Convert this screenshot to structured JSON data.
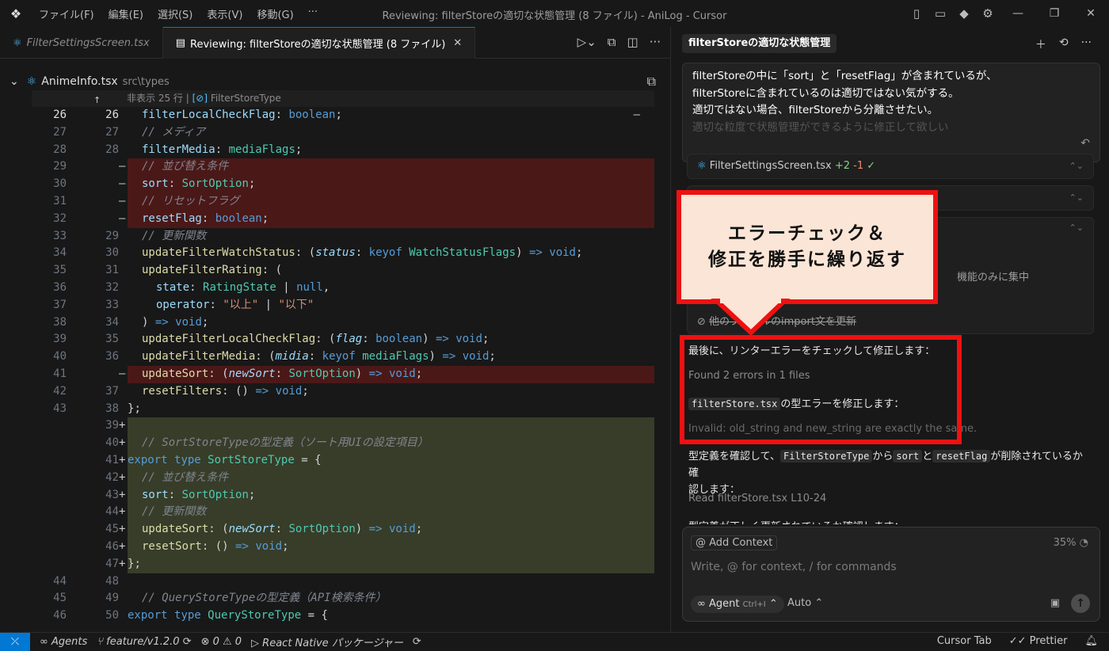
{
  "app": {
    "window_title": "Reviewing: filterStoreの適切な状態管理 (8 ファイル) - AniLog - Cursor",
    "menu": [
      "ファイル(F)",
      "編集(E)",
      "選択(S)",
      "表示(V)",
      "移動(G)",
      "···"
    ]
  },
  "tabs": [
    {
      "label": "FilterSettingsScreen.tsx"
    },
    {
      "label": "Reviewing: filterStoreの適切な状態管理 (8 ファイル)"
    }
  ],
  "breadcrumb": {
    "file": "AnimeInfo.tsx",
    "path": "src\\types"
  },
  "code": {
    "hidden_label": "非表示 25 行 | ",
    "hidden_symbol": "FilterStoreType",
    "lines": [
      {
        "o": "26",
        "n": "26",
        "t": "",
        "text": "filterLocalCheckFlag: boolean;"
      },
      {
        "o": "27",
        "n": "27",
        "t": "",
        "text": "// メディア"
      },
      {
        "o": "28",
        "n": "28",
        "t": "",
        "text": "filterMedia: mediaFlags;"
      },
      {
        "o": "29",
        "n": "",
        "t": "del",
        "text": "// 並び替え条件"
      },
      {
        "o": "30",
        "n": "",
        "t": "del",
        "text": "sort: SortOption;"
      },
      {
        "o": "31",
        "n": "",
        "t": "del",
        "text": "// リセットフラグ"
      },
      {
        "o": "32",
        "n": "",
        "t": "del",
        "text": "resetFlag: boolean;"
      },
      {
        "o": "33",
        "n": "29",
        "t": "",
        "text": "// 更新関数"
      },
      {
        "o": "34",
        "n": "30",
        "t": "",
        "text": "updateFilterWatchStatus: (status: keyof WatchStatusFlags) => void;"
      },
      {
        "o": "35",
        "n": "31",
        "t": "",
        "text": "updateFilterRating: ("
      },
      {
        "o": "36",
        "n": "32",
        "t": "",
        "text": "state: RatingState | null,"
      },
      {
        "o": "37",
        "n": "33",
        "t": "",
        "text": "operator: \"以上\" | \"以下\""
      },
      {
        "o": "38",
        "n": "34",
        "t": "",
        "text": ") => void;"
      },
      {
        "o": "39",
        "n": "35",
        "t": "",
        "text": "updateFilterLocalCheckFlag: (flag: boolean) => void;"
      },
      {
        "o": "40",
        "n": "36",
        "t": "",
        "text": "updateFilterMedia: (midia: keyof mediaFlags) => void;"
      },
      {
        "o": "41",
        "n": "",
        "t": "del",
        "text": "updateSort: (newSort: SortOption) => void;"
      },
      {
        "o": "42",
        "n": "37",
        "t": "",
        "text": "resetFilters: () => void;"
      },
      {
        "o": "43",
        "n": "38",
        "t": "",
        "text": "};"
      },
      {
        "o": "",
        "n": "39",
        "t": "add",
        "text": ""
      },
      {
        "o": "",
        "n": "40",
        "t": "add",
        "text": "// SortStoreTypeの型定義（ソート用UIの設定項目）"
      },
      {
        "o": "",
        "n": "41",
        "t": "add",
        "text": "export type SortStoreType = {"
      },
      {
        "o": "",
        "n": "42",
        "t": "add",
        "text": "// 並び替え条件"
      },
      {
        "o": "",
        "n": "43",
        "t": "add",
        "text": "sort: SortOption;"
      },
      {
        "o": "",
        "n": "44",
        "t": "add",
        "text": "// 更新関数"
      },
      {
        "o": "",
        "n": "45",
        "t": "add",
        "text": "updateSort: (newSort: SortOption) => void;"
      },
      {
        "o": "",
        "n": "46",
        "t": "add",
        "text": "resetSort: () => void;"
      },
      {
        "o": "",
        "n": "47",
        "t": "add",
        "text": "};"
      },
      {
        "o": "44",
        "n": "48",
        "t": "",
        "text": ""
      },
      {
        "o": "45",
        "n": "49",
        "t": "",
        "text": "// QueryStoreTypeの型定義（API検索条件）"
      },
      {
        "o": "46",
        "n": "50",
        "t": "",
        "text": "export type QueryStoreType = {"
      }
    ]
  },
  "chat": {
    "header": "filterStoreの適切な状態管理",
    "user_message": [
      "filterStoreの中に「sort」と「resetFlag」が含まれているが、",
      "filterStoreに含まれているのは適切ではない気がする。",
      "適切ではない場合、filterStoreから分離させたい。",
      "適切な粒度で状態管理ができるように修正して欲しい"
    ],
    "file_card": {
      "name": "FilterSettingsScreen.tsx",
      "plus": "+2",
      "minus": "-1"
    },
    "task_partial": "機能のみに集中",
    "task_last": "他のファイルのimport文を更新",
    "callout_lines": [
      "エラーチェック＆",
      "修正を勝手に繰り返す"
    ],
    "msg1": "最後に、リンターエラーをチェックして修正します：",
    "msg2": "Found 2 errors in 1 files",
    "msg3_code": "filterStore.tsx",
    "msg3_rest": "の型エラーを修正します：",
    "msg4": "Invalid: old_string and new_string are exactly the same.",
    "msg5_a": "型定義を確認して、",
    "msg5_code1": "FilterStoreType",
    "msg5_b": "から",
    "msg5_code2": "sort",
    "msg5_c": "と",
    "msg5_code3": "resetFlag",
    "msg5_d": "が削除されているか確",
    "msg5_e": "認します：",
    "msg6": "Read filterStore.tsx L10-24",
    "msg7": "型定義が正しく更新されているか確認します："
  },
  "input": {
    "add_context": "@ Add Context",
    "percent": "35%",
    "placeholder": "Write, @ for context, / for commands",
    "agent": "Agent",
    "agent_shortcut": "Ctrl+I",
    "model": "Auto"
  },
  "status": {
    "agents": "Agents",
    "branch": "feature/v1.2.0",
    "errors": "0",
    "warnings": "0",
    "run": "React Native パッケージャー",
    "cursor_tab": "Cursor Tab",
    "prettier": "Prettier"
  }
}
